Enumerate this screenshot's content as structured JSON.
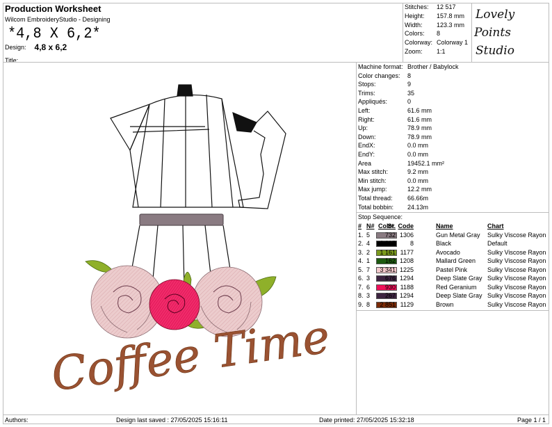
{
  "header": {
    "title": "Production Worksheet",
    "software": "Wilcom EmbroideryStudio - Designing",
    "size_large": "*4,8 X 6,2*",
    "design_label": "Design:",
    "design_value": "4,8 x 6,2",
    "title_label": "Title:"
  },
  "stats": [
    {
      "k": "Stitches:",
      "v": "12 517"
    },
    {
      "k": "Height:",
      "v": "157.8 mm"
    },
    {
      "k": "Width:",
      "v": "123.3 mm"
    },
    {
      "k": "Colors:",
      "v": "8"
    },
    {
      "k": "Colorway:",
      "v": "Colorway 1"
    },
    {
      "k": "Zoom:",
      "v": "1:1"
    }
  ],
  "logo": {
    "line1": "Lovely",
    "line2": "Points",
    "line3": "Studio"
  },
  "machine": [
    {
      "k": "Machine format:",
      "v": "Brother / Babylock"
    },
    {
      "k": "Color changes:",
      "v": "8"
    },
    {
      "k": "Stops:",
      "v": "9"
    },
    {
      "k": "Trims:",
      "v": "35"
    },
    {
      "k": "Appliqués:",
      "v": "0"
    },
    {
      "k": "Left:",
      "v": "61.6 mm"
    },
    {
      "k": "Right:",
      "v": "61.6 mm"
    },
    {
      "k": "Up:",
      "v": "78.9 mm"
    },
    {
      "k": "Down:",
      "v": "78.9 mm"
    },
    {
      "k": "EndX:",
      "v": "0.0 mm"
    },
    {
      "k": "EndY:",
      "v": "0.0 mm"
    },
    {
      "k": "Area",
      "v": "19452.1 mm²"
    },
    {
      "k": "Max stitch:",
      "v": "9.2 mm"
    },
    {
      "k": "Min stitch:",
      "v": "0.0 mm"
    },
    {
      "k": "Max jump:",
      "v": "12.2 mm"
    },
    {
      "k": "Total thread:",
      "v": "66.66m"
    },
    {
      "k": "Total bobbin:",
      "v": "24.13m"
    }
  ],
  "stop_sequence": {
    "title": "Stop Sequence:",
    "headers": {
      "num": "#",
      "n": "N#",
      "color": "Color",
      "st": "St.",
      "code": "Code",
      "name": "Name",
      "chart": "Chart"
    },
    "rows": [
      {
        "num": "1.",
        "n": "5",
        "color": "#8a7b82",
        "st": "732",
        "code": "1306",
        "name": "Gun Metal Gray",
        "chart": "Sulky Viscose Rayon"
      },
      {
        "num": "2.",
        "n": "4",
        "color": "#000000",
        "st": "2 397",
        "code": "8",
        "name": "Black",
        "chart": "Default"
      },
      {
        "num": "3.",
        "n": "2",
        "color": "#7a9a1c",
        "st": "1 161",
        "code": "1177",
        "name": "Avocado",
        "chart": "Sulky Viscose Rayon"
      },
      {
        "num": "4.",
        "n": "1",
        "color": "#1d5a10",
        "st": "162",
        "code": "1208",
        "name": "Mallard Green",
        "chart": "Sulky Viscose Rayon"
      },
      {
        "num": "5.",
        "n": "7",
        "color": "#f4c9cc",
        "st": "3 341",
        "code": "1225",
        "name": "Pastel Pink",
        "chart": "Sulky Viscose Rayon"
      },
      {
        "num": "6.",
        "n": "3",
        "color": "#3d2440",
        "st": "676",
        "code": "1294",
        "name": "Deep Slate Gray",
        "chart": "Sulky Viscose Rayon"
      },
      {
        "num": "7.",
        "n": "6",
        "color": "#f0105a",
        "st": "930",
        "code": "1188",
        "name": "Red Geranium",
        "chart": "Sulky Viscose Rayon"
      },
      {
        "num": "8.",
        "n": "3",
        "color": "#3d2440",
        "st": "267",
        "code": "1294",
        "name": "Deep Slate Gray",
        "chart": "Sulky Viscose Rayon"
      },
      {
        "num": "9.",
        "n": "8",
        "color": "#7a2a06",
        "st": "2 851",
        "code": "1129",
        "name": "Brown",
        "chart": "Sulky Viscose Rayon"
      }
    ]
  },
  "design_text": "Coffee Time",
  "footer": {
    "authors": "Authors:",
    "saved": "Design last saved : 27/05/2025 15:16:11",
    "printed": "Date printed: 27/05/2025 15:32:18",
    "page": "Page 1 / 1"
  }
}
